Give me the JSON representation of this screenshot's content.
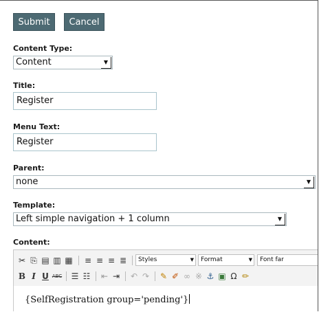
{
  "buttons": {
    "submit": "Submit",
    "cancel": "Cancel"
  },
  "content_type": {
    "label": "Content Type:",
    "value": "Content"
  },
  "title": {
    "label": "Title:",
    "value": "Register"
  },
  "menu_text": {
    "label": "Menu Text:",
    "value": "Register"
  },
  "parent": {
    "label": "Parent:",
    "value": "none"
  },
  "template": {
    "label": "Template:",
    "value": "Left simple navigation + 1 column"
  },
  "content": {
    "label": "Content:",
    "toolbar": {
      "styles": "Styles",
      "format": "Format",
      "font": "Font far"
    },
    "body_text": "{SelfRegistration group='pending'}"
  },
  "colors": {
    "button_bg": "#4d6a73",
    "input_border": "#a9c4cc"
  }
}
